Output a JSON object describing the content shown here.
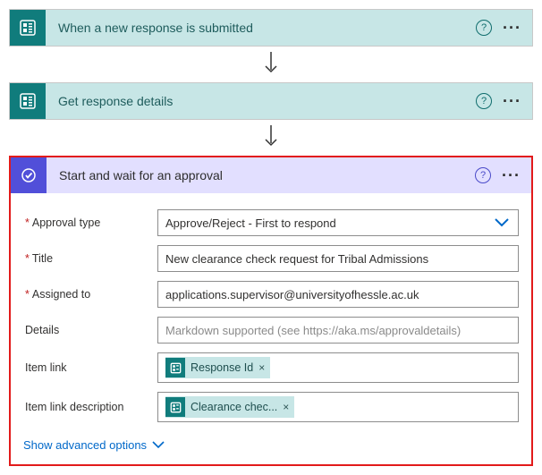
{
  "steps": {
    "forms_trigger": {
      "title": "When a new response is submitted"
    },
    "forms_action": {
      "title": "Get response details"
    },
    "approval": {
      "title": "Start and wait for an approval"
    }
  },
  "approvalForm": {
    "labels": {
      "approvalType": "Approval type",
      "title": "Title",
      "assignedTo": "Assigned to",
      "details": "Details",
      "itemLink": "Item link",
      "itemLinkDesc": "Item link description"
    },
    "values": {
      "approvalType": "Approve/Reject - First to respond",
      "title": "New clearance check request for Tribal Admissions",
      "assignedTo": "applications.supervisor@universityofhessle.ac.uk",
      "detailsPlaceholder": "Markdown supported (see https://aka.ms/approvaldetails)",
      "tokenResponseId": "Response Id",
      "tokenClearance": "Clearance chec..."
    },
    "advanced": "Show advanced options"
  }
}
